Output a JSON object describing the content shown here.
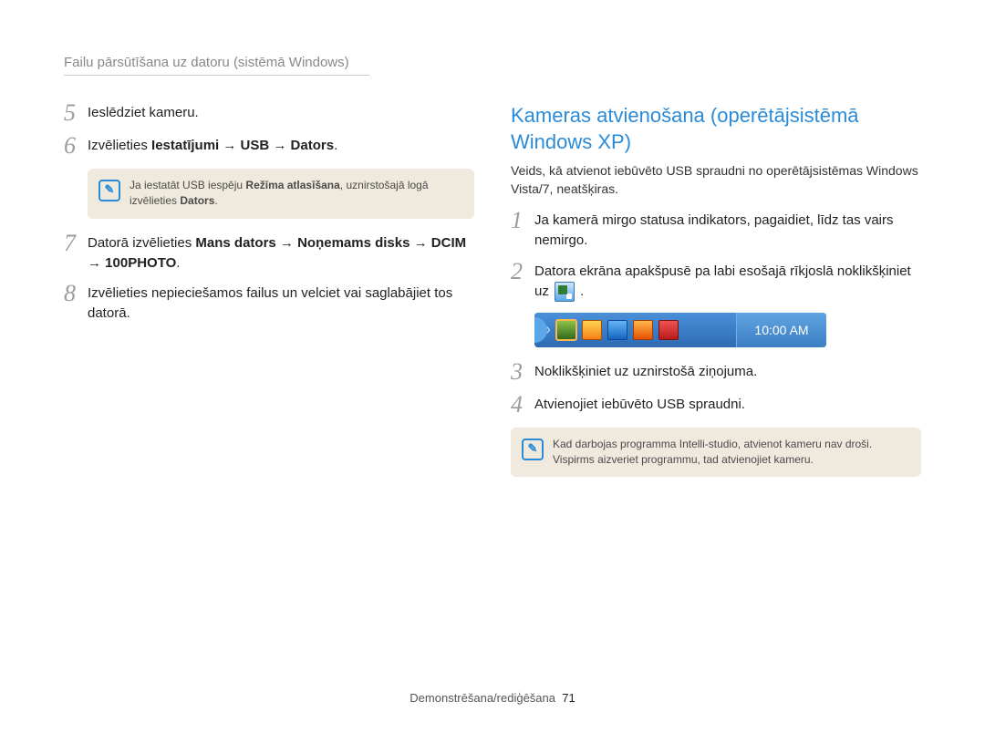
{
  "breadcrumb": "Failu pārsūtīšana uz datoru (sistēmā Windows)",
  "left": {
    "steps": [
      {
        "num": "5",
        "html": "Ieslēdziet kameru."
      },
      {
        "num": "6",
        "html": "Izvēlieties <b>Iestatījumi → USB → Dators</b>."
      },
      {
        "num": "7",
        "html": "Datorā izvēlieties <b>Mans dators → Noņemams disks → DCIM → 100PHOTO</b>."
      },
      {
        "num": "8",
        "html": "Izvēlieties nepieciešamos failus un velciet vai saglabājiet tos datorā."
      }
    ],
    "note": "Ja iestatāt USB iespēju <b>Režīma atlasīšana</b>, uznirstošajā logā izvēlieties <b>Dators</b>."
  },
  "right": {
    "heading": "Kameras atvienošana (operētājsistēmā Windows XP)",
    "intro": "Veids, kā atvienot iebūvēto USB spraudni no operētājsistēmas Windows Vista/7, neatšķiras.",
    "steps": [
      {
        "num": "1",
        "html": "Ja kamerā mirgo statusa indikators, pagaidiet, līdz tas vairs nemirgo."
      },
      {
        "num": "2",
        "html": "Datora ekrāna apakšpusē pa labi esošajā rīkjoslā noklikšķiniet uz <span class=\"inline-tray-icon\" data-name=\"safely-remove-hardware-icon\" data-interactable=\"false\"></span> ."
      },
      {
        "num": "3",
        "html": "Noklikšķiniet uz uznirstošā ziņojuma."
      },
      {
        "num": "4",
        "html": "Atvienojiet iebūvēto USB spraudni."
      }
    ],
    "note": "Kad darbojas programma Intelli-studio, atvienot kameru nav droši. Vispirms aizveriet programmu, tad atvienojiet kameru.",
    "taskbar_clock": "10:00 AM"
  },
  "footer": {
    "section": "Demonstrēšana/rediģēšana",
    "page": "71"
  }
}
